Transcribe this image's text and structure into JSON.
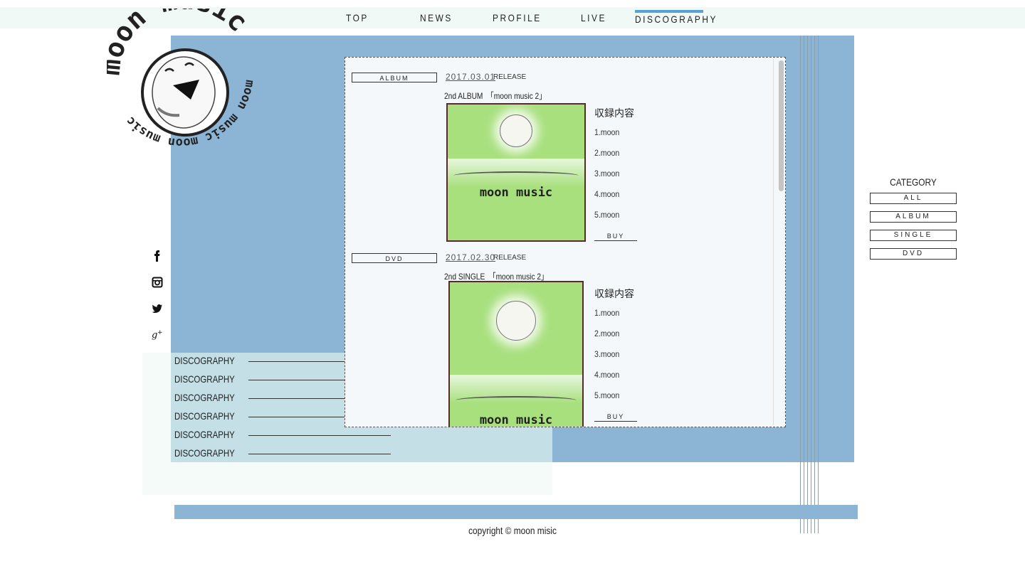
{
  "nav": {
    "items": [
      {
        "label": "TOP"
      },
      {
        "label": "NEWS"
      },
      {
        "label": "PROFILE"
      },
      {
        "label": "LIVE"
      },
      {
        "label": "DISCOGRAPHY",
        "active": true
      }
    ],
    "active_color": "#55a3d6"
  },
  "brand": {
    "logo_text_top": "moon music",
    "logo_text_ring": "moon music moon music"
  },
  "social": [
    "facebook-icon",
    "instagram-icon",
    "twitter-icon",
    "google-plus-icon"
  ],
  "submenu": {
    "items": [
      "DISCOGRAPHY",
      "DISCOGRAPHY",
      "DISCOGRAPHY",
      "DISCOGRAPHY",
      "DISCOGRAPHY",
      "DISCOGRAPHY"
    ]
  },
  "releases": [
    {
      "category": "ALBUM",
      "date": "2017.03.01",
      "release_label": "RELEASE",
      "title": "2nd ALBUM　「moon music 2」",
      "cover_text": "moon music",
      "tracks_title": "収録内容",
      "tracks": [
        "1.moon",
        "2.moon",
        "3.moon",
        "4.moon",
        "5.moon"
      ],
      "buy_label": "BUY"
    },
    {
      "category": "DVD",
      "date": "2017.02.30",
      "release_label": "RELEASE",
      "title": "2nd SINGLE　「moon music 2」",
      "cover_text": "moon music",
      "tracks_title": "収録内容",
      "tracks": [
        "1.moon",
        "2.moon",
        "3.moon",
        "4.moon",
        "5.moon"
      ],
      "buy_label": "BUY"
    }
  ],
  "category": {
    "title": "CATEGORY",
    "items": [
      "ALL",
      "ALBUM",
      "SINGLE",
      "DVD"
    ]
  },
  "footer": {
    "copyright": "copyright © moon misic"
  },
  "colors": {
    "panel_blue": "#8cb4d4",
    "cover_green": "#a8e07e",
    "nav_bg": "#f1f9f6"
  }
}
